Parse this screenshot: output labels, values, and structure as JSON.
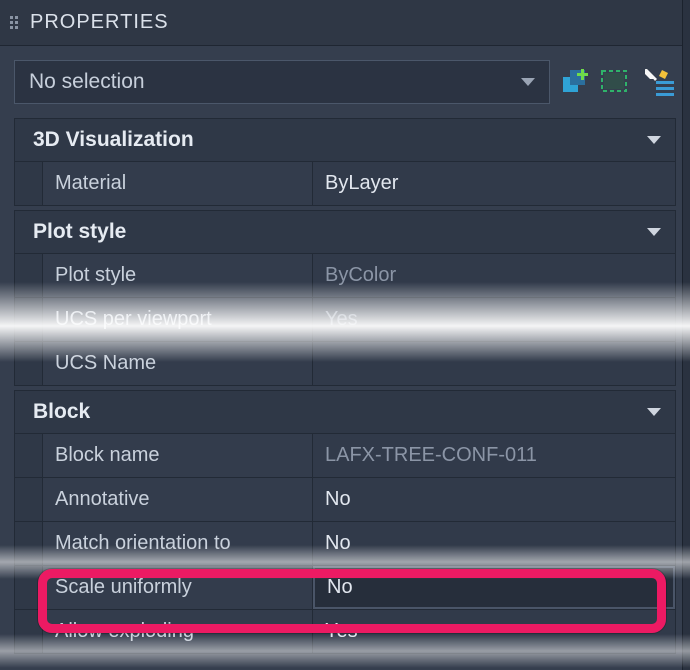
{
  "panel": {
    "title": "PROPERTIES"
  },
  "selector": {
    "value": "No selection"
  },
  "groups": {
    "viz": {
      "title": "3D Visualization",
      "material_label": "Material",
      "material_value": "ByLayer"
    },
    "plot": {
      "title": "Plot style",
      "plotstyle_label": "Plot style",
      "plotstyle_value": "ByColor",
      "ucs_per_vp_label": "UCS per viewport",
      "ucs_per_vp_value": "Yes",
      "ucs_name_label": "UCS Name",
      "ucs_name_value": ""
    },
    "block": {
      "title": "Block",
      "blockname_label": "Block name",
      "blockname_value": "LAFX-TREE-CONF-011",
      "annotative_label": "Annotative",
      "annotative_value": "No",
      "matchorient_label": "Match orientation to",
      "matchorient_value": "No",
      "scaleuniform_label": "Scale uniformly",
      "scaleuniform_value": "No",
      "allowexplode_label": "Allow exploding",
      "allowexplode_value": "Yes"
    }
  },
  "icons": {
    "add_selection": "add-selection-icon",
    "quick_select": "quick-select-icon",
    "settings": "properties-settings-icon"
  }
}
